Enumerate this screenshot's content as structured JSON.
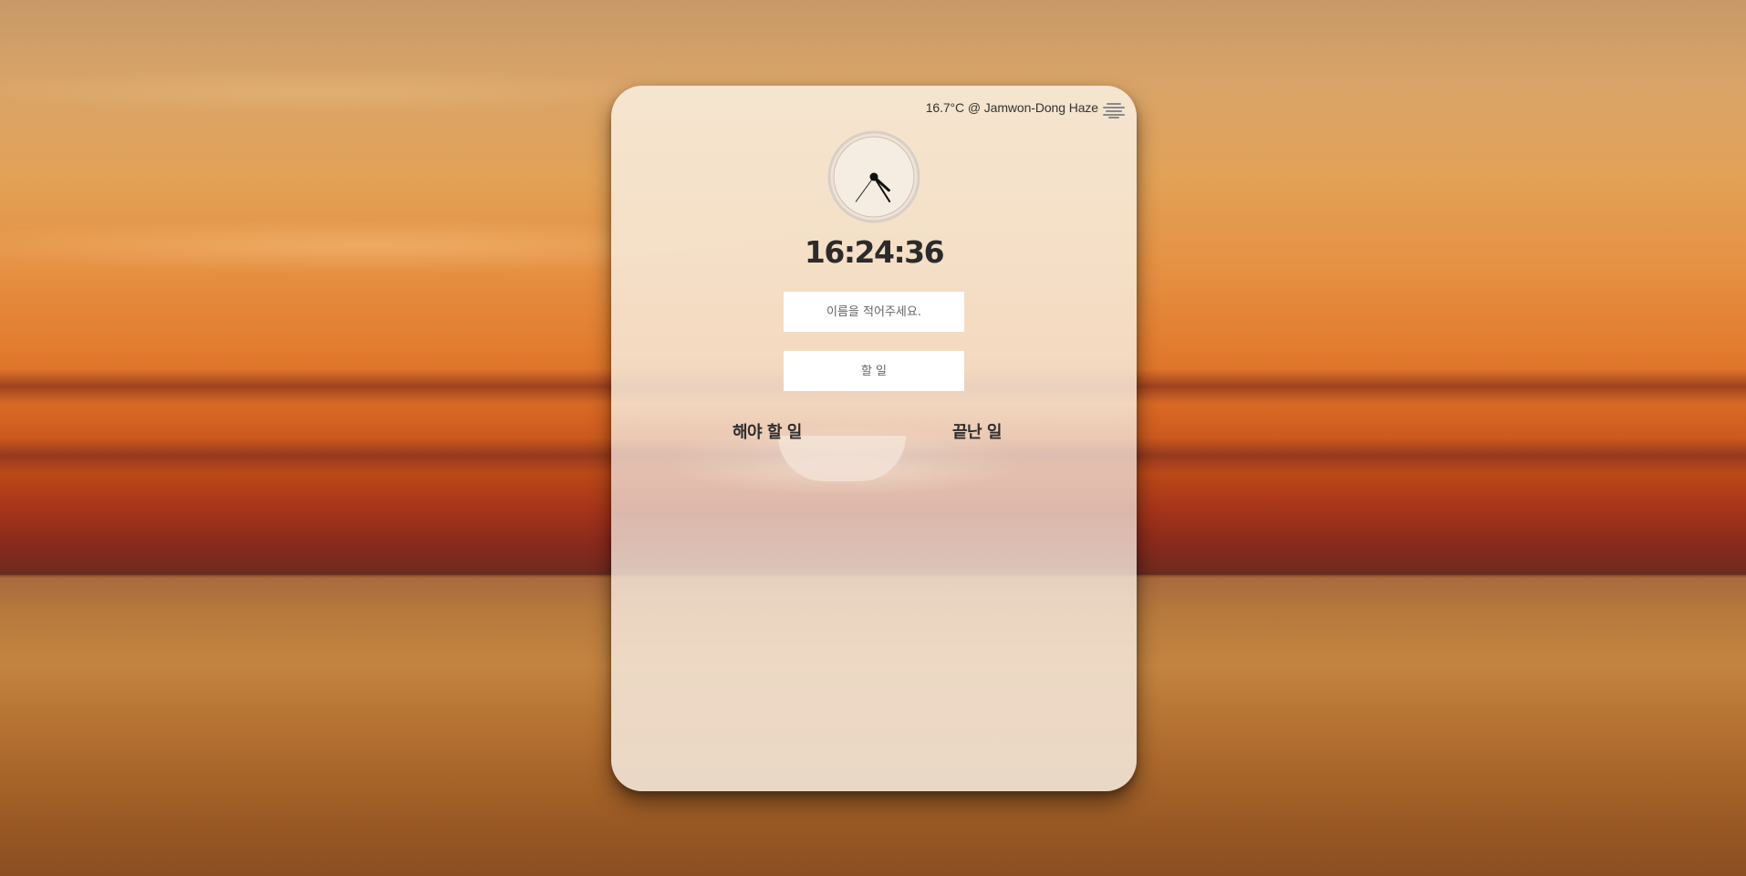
{
  "weather": {
    "text": "16.7°C @ Jamwon-Dong Haze",
    "icon": "haze-icon"
  },
  "clock": {
    "digital_time": "16:24:36",
    "hours": 16,
    "minutes": 24,
    "seconds": 36
  },
  "form": {
    "name_placeholder": "이름을 적어주세요.",
    "todo_placeholder": "할 일"
  },
  "lists": {
    "todo_title": "해야 할 일",
    "done_title": "끝난 일"
  },
  "colors": {
    "text": "#2e2e2e",
    "card": "#f6e8d6"
  }
}
